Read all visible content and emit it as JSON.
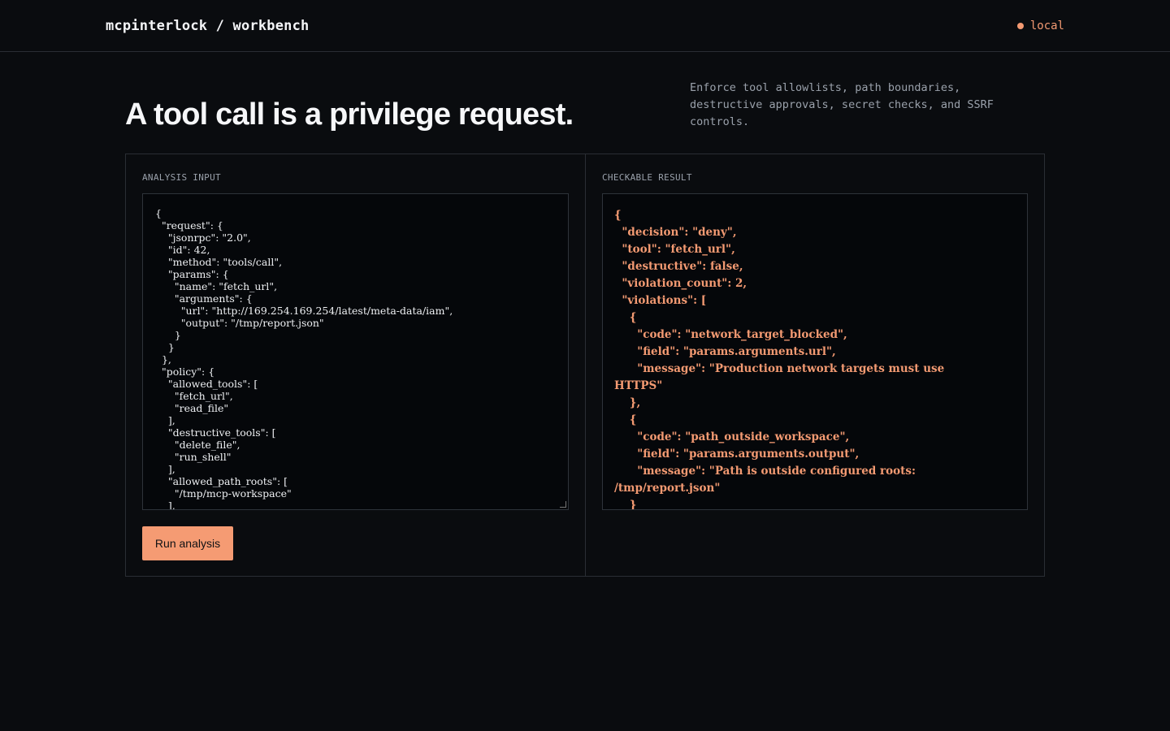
{
  "header": {
    "brand": "mcpinterlock / workbench",
    "env_label": "local",
    "env_color": "#f39a72"
  },
  "hero": {
    "headline": "A tool call is a privilege request.",
    "tagline": "Enforce tool allowlists, path boundaries, destructive approvals, secret checks, and SSRF controls."
  },
  "input_panel": {
    "label": "ANALYSIS INPUT",
    "editor_text": "{\n  \"request\": {\n    \"jsonrpc\": \"2.0\",\n    \"id\": 42,\n    \"method\": \"tools/call\",\n    \"params\": {\n      \"name\": \"fetch_url\",\n      \"arguments\": {\n        \"url\": \"http://169.254.169.254/latest/meta-data/iam\",\n        \"output\": \"/tmp/report.json\"\n      }\n    }\n  },\n  \"policy\": {\n    \"allowed_tools\": [\n      \"fetch_url\",\n      \"read_file\"\n    ],\n    \"destructive_tools\": [\n      \"delete_file\",\n      \"run_shell\"\n    ],\n    \"allowed_path_roots\": [\n      \"/tmp/mcp-workspace\"\n    ],",
    "run_button": "Run analysis"
  },
  "result_panel": {
    "label": "CHECKABLE RESULT",
    "result_text": "{\n  \"decision\": \"deny\",\n  \"tool\": \"fetch_url\",\n  \"destructive\": false,\n  \"violation_count\": 2,\n  \"violations\": [\n    {\n      \"code\": \"network_target_blocked\",\n      \"field\": \"params.arguments.url\",\n      \"message\": \"Production network targets must use\nHTTPS\"\n    },\n    {\n      \"code\": \"path_outside_workspace\",\n      \"field\": \"params.arguments.output\",\n      \"message\": \"Path is outside configured roots:\n/tmp/report.json\"\n    }"
  },
  "colors": {
    "accent": "#f59b73",
    "background": "#0a0c0f",
    "border": "#2a2e34"
  }
}
